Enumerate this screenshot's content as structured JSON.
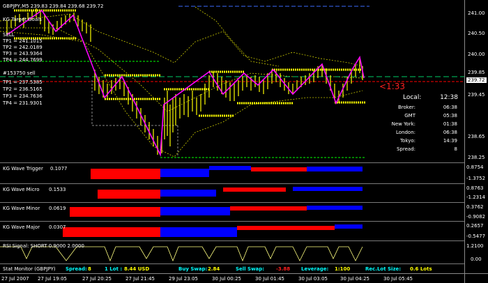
{
  "header": {
    "symbol_line": "GBPJPY,M5 239.83 239.84 239.68 239.72",
    "kg_target_label": "KG Target Goals"
  },
  "targets_up": {
    "sell_label": "SELL",
    "tp1": "TP1 = 241.1015",
    "tp2": "TP2 = 242.0189",
    "tp3": "TP3 = 243.9364",
    "tp4": "TP4 = 244.7699"
  },
  "targets_down": {
    "sell_label": "#153750 sell",
    "tp1": "TP1 = 237.5385",
    "tp2": "TP2 = 236.5165",
    "tp3": "TP3 = 234.7636",
    "tp4": "TP4 = 231.9301"
  },
  "countdown": "<1:33",
  "info": {
    "title_key": "Local:",
    "title_val": "12:38",
    "rows": [
      {
        "k": "Broker:",
        "v": "06:38"
      },
      {
        "k": "GMT",
        "v": "05:38"
      },
      {
        "k": "New York:",
        "v": "01:38"
      },
      {
        "k": "London:",
        "v": "06:38"
      },
      {
        "k": "Tokyo:",
        "v": "14:39"
      },
      {
        "k": "Spread:",
        "v": "8"
      }
    ]
  },
  "price_axis": {
    "labels": [
      "241.00",
      "240.50",
      "240.00",
      "239.85",
      "239.72",
      "239.45",
      "238.65",
      "238.25"
    ],
    "current": "239.72"
  },
  "indicators": [
    {
      "name": "KG Wave Trigger",
      "value": "0.1077",
      "scale_top": "0.8754",
      "scale_bottom": "-1.3752"
    },
    {
      "name": "KG Wave Micro",
      "value": "0.1533",
      "scale_top": "0.8763",
      "scale_bottom": "-1.2314"
    },
    {
      "name": "KG Wave Minor",
      "value": "0.0619",
      "scale_top": "0.3762",
      "scale_bottom": "-0.9082"
    },
    {
      "name": "KG Wave Major",
      "value": "0.0307",
      "scale_top": "0.2657",
      "scale_bottom": "-0.5477"
    },
    {
      "name": "RSI Signal: SHORT 0.9000 2.0000",
      "value": "",
      "scale_top": "1.2100",
      "scale_bottom": "0.00"
    }
  ],
  "status_bar": {
    "label": "Stat Monitor (GBPJPY)",
    "spread_k": "Spread:",
    "spread_v": "8",
    "lot_k": "1 Lot :",
    "lot_v": "8.44 USD",
    "buy_k": "Buy Swap:",
    "buy_v": "2.84",
    "sell_k": "Sell Swap:",
    "sell_v": "-3.88",
    "lev_k": "Leverage:",
    "lev_v": "1:100",
    "rec_k": "Rec.Lot Size:",
    "rec_v": "0.6 Lots"
  },
  "time_axis": [
    "27 Jul 2007",
    "27 Jul 19:05",
    "27 Jul 20:25",
    "27 Jul 21:45",
    "29 Jul 23:05",
    "30 Jul 00:25",
    "30 Jul 01:45",
    "30 Jul 03:05",
    "30 Jul 04:25",
    "30 Jul 05:45"
  ],
  "colors": {
    "candle": "#ffff00",
    "zigzag": "#ff00ff",
    "target": "#ffff00",
    "green": "#00ff00",
    "red": "#ff0000",
    "blue": "#0000ff",
    "cyan": "#00ffff",
    "band": "#cccc00"
  }
}
